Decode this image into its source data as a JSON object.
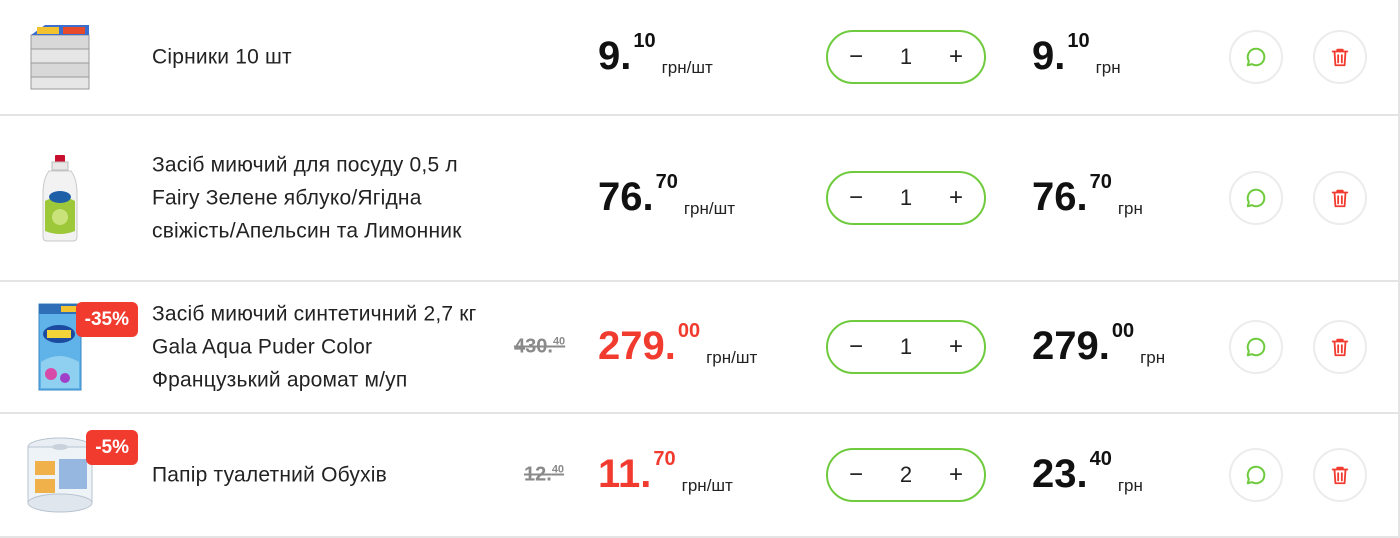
{
  "items": [
    {
      "name": "Сірники 10 шт",
      "discount": "",
      "old_price_int": "",
      "old_price_cents": "",
      "price_int": "9.",
      "price_cents": "10",
      "price_unit": "грн/шт",
      "quantity": "1",
      "total_int": "9.",
      "total_cents": "10",
      "total_unit": "грн"
    },
    {
      "name": "Засіб миючий для посуду 0,5 л Fairy Зелене яблуко/Ягідна свіжість/Апельсин та Лимонник",
      "discount": "",
      "old_price_int": "",
      "old_price_cents": "",
      "price_int": "76.",
      "price_cents": "70",
      "price_unit": "грн/шт",
      "quantity": "1",
      "total_int": "76.",
      "total_cents": "70",
      "total_unit": "грн"
    },
    {
      "name": "Засіб миючий синтетичний 2,7 кг Gala Aqua Puder Color Французький аромат м/уп",
      "discount": "-35%",
      "old_price_int": "430.",
      "old_price_cents": "40",
      "price_int": "279.",
      "price_cents": "00",
      "price_unit": "грн/шт",
      "quantity": "1",
      "total_int": "279.",
      "total_cents": "00",
      "total_unit": "грн"
    },
    {
      "name": "Папір туалетний Обухів",
      "discount": "-5%",
      "old_price_int": "12.",
      "old_price_cents": "40",
      "price_int": "11.",
      "price_cents": "70",
      "price_unit": "грн/шт",
      "quantity": "2",
      "total_int": "23.",
      "total_cents": "40",
      "total_unit": "грн"
    }
  ],
  "controls": {
    "minus": "−",
    "plus": "+"
  },
  "icons": {
    "comment": "chat-bubble-icon",
    "delete": "trash-icon"
  },
  "colors": {
    "accent_green": "#6fcb3d",
    "sale_red": "#f23b2f",
    "delete_red": "#f23b2f"
  }
}
